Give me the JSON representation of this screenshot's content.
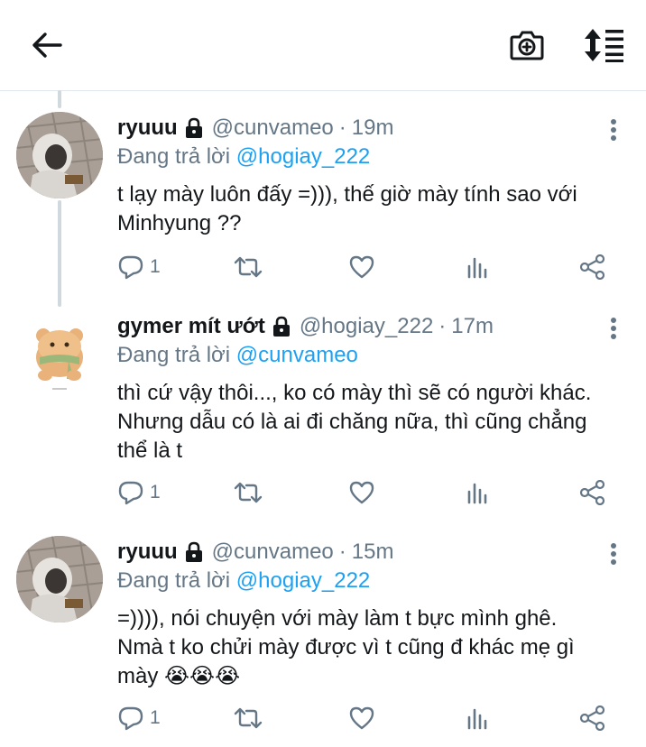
{
  "toolbar": {
    "back": "back-arrow-icon",
    "camera": "camera-add-icon",
    "sort": "sort-icon"
  },
  "tweets": [
    {
      "display_name": "ryuuu",
      "handle": "@cunvameo",
      "separator": "·",
      "time": "19m",
      "replying_prefix": "Đang trả lời",
      "replying_to": "@hogiay_222",
      "text_lines": [
        "t lạy mày luôn đấy =))), thế giờ mày tính sao với",
        "Minhyung ??"
      ],
      "reply_count": "1"
    },
    {
      "display_name": "gymer mít ướt",
      "handle": "@hogiay_222",
      "separator": "·",
      "time": "17m",
      "replying_prefix": "Đang trả lời",
      "replying_to": "@cunvameo",
      "text_lines": [
        "thì cứ vậy thôi..., ko có mày thì sẽ có người khác.",
        "Nhưng dẫu có là ai đi chăng nữa, thì cũng chẳng",
        "thể là t"
      ],
      "reply_count": "1"
    },
    {
      "display_name": "ryuuu",
      "handle": "@cunvameo",
      "separator": "·",
      "time": "15m",
      "replying_prefix": "Đang trả lời",
      "replying_to": "@hogiay_222",
      "text_lines": [
        "=)))), nói chuyện với mày làm t bực mình ghê.",
        "Nmà t ko chửi mày được vì t cũng đ khác mẹ gì",
        "mày 😭😭😭"
      ],
      "reply_count": "1"
    }
  ],
  "colors": {
    "accent": "#1da1f2",
    "muted": "#657786",
    "thread_line": "#cfd9de",
    "divider": "#e1e8ed"
  }
}
